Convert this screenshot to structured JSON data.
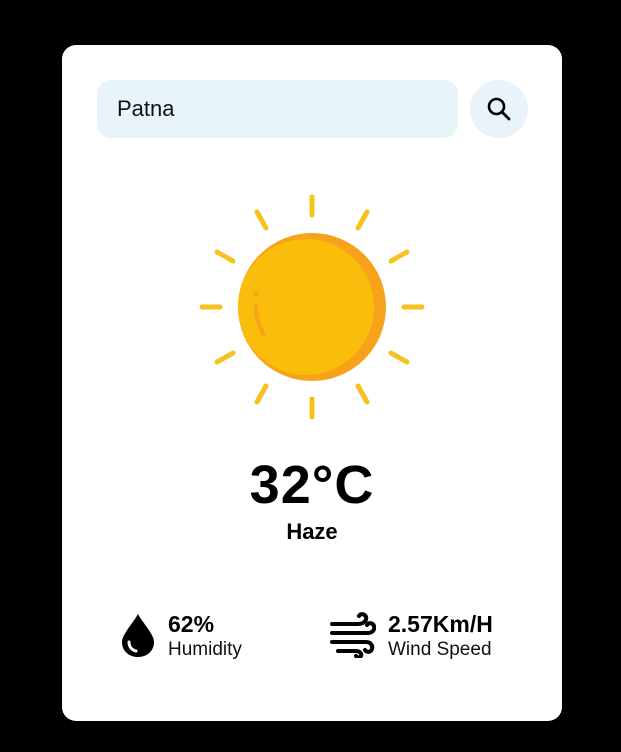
{
  "search": {
    "value": "Patna",
    "icon": "search-icon"
  },
  "weather": {
    "icon": "sun-icon",
    "temperature": "32°C",
    "condition": "Haze"
  },
  "humidity": {
    "value": "62%",
    "label": "Humidity",
    "icon": "water-drop-icon"
  },
  "wind": {
    "value": "2.57Km/H",
    "label": "Wind Speed",
    "icon": "wind-icon"
  },
  "colors": {
    "page_background": "#000000",
    "card_background": "#ffffff",
    "search_background": "#e8f3fa",
    "sun_yellow": "#fbbd0b",
    "sun_orange": "#f7a21b",
    "ray_yellow": "#f7c21b"
  }
}
